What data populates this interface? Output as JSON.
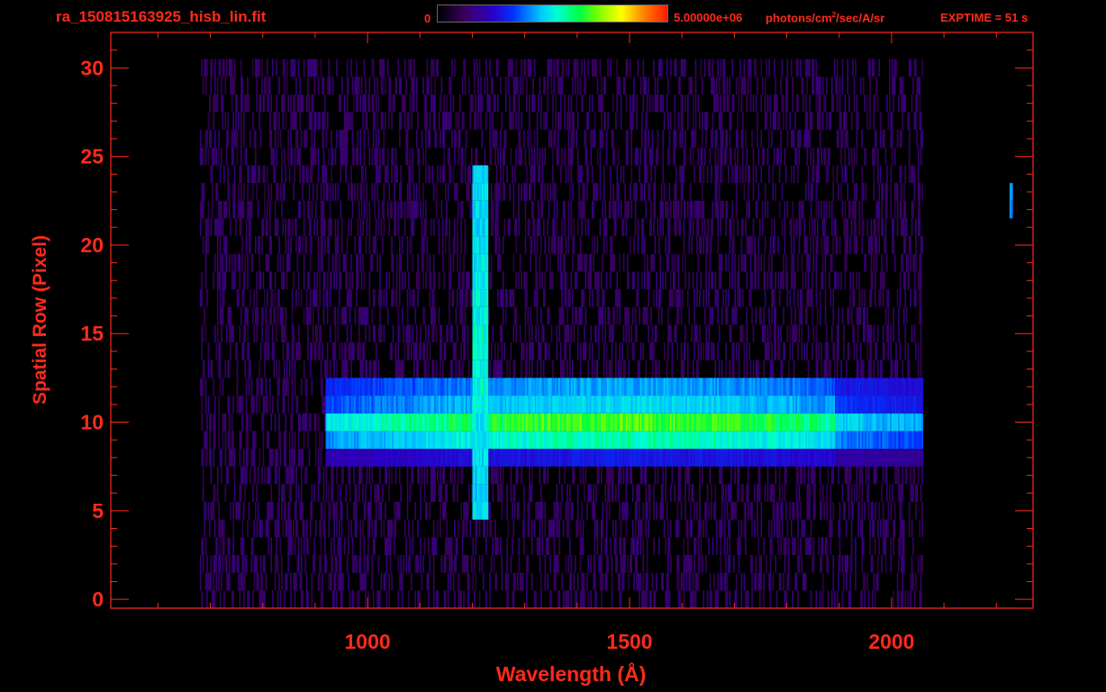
{
  "header": {
    "filename": "ra_150815163925_hisb_lin.fit",
    "colorbar_min": "0",
    "colorbar_max": "5.00000e+06",
    "units_prefix": "photons/cm",
    "units_sup": "2",
    "units_suffix": "/sec/A/sr",
    "exptime": "EXPTIME = 51 s"
  },
  "colors": {
    "axis": "#ff2a1a",
    "background": "#000000"
  },
  "chart_data": {
    "type": "heatmap",
    "title": "ra_150815163925_hisb_lin.fit",
    "xlabel": "Wavelength (Å)",
    "ylabel": "Spatial Row (Pixel)",
    "xlim": [
      510,
      2270
    ],
    "ylim": [
      -0.5,
      32
    ],
    "xticks": [
      1000,
      1500,
      2000
    ],
    "yticks": [
      0,
      5,
      10,
      15,
      20,
      25,
      30
    ],
    "color_range": [
      0,
      5000000
    ],
    "colorbar_label": "photons/cm2/sec/A/sr",
    "colormap": "rainbow (black-purple-blue-cyan-green-yellow-red)",
    "background_noise": {
      "x_range": [
        680,
        2060
      ],
      "row_range": [
        0,
        30
      ],
      "level": 0.05
    },
    "features": [
      {
        "label": "spectrum trace",
        "x": [
          920,
          2060
        ],
        "rows": [
          8,
          12
        ],
        "row_levels": {
          "8": 0.22,
          "9": 0.48,
          "10": 0.6,
          "11": 0.4,
          "12": 0.35
        }
      },
      {
        "label": "Lyman-alpha line",
        "x": [
          1200,
          1230
        ],
        "rows": [
          5,
          24
        ],
        "peak_level": 0.52
      },
      {
        "label": "isolated bright pixel",
        "x": [
          2225,
          2230
        ],
        "rows": [
          22,
          23
        ],
        "peak_level": 0.42
      }
    ]
  }
}
